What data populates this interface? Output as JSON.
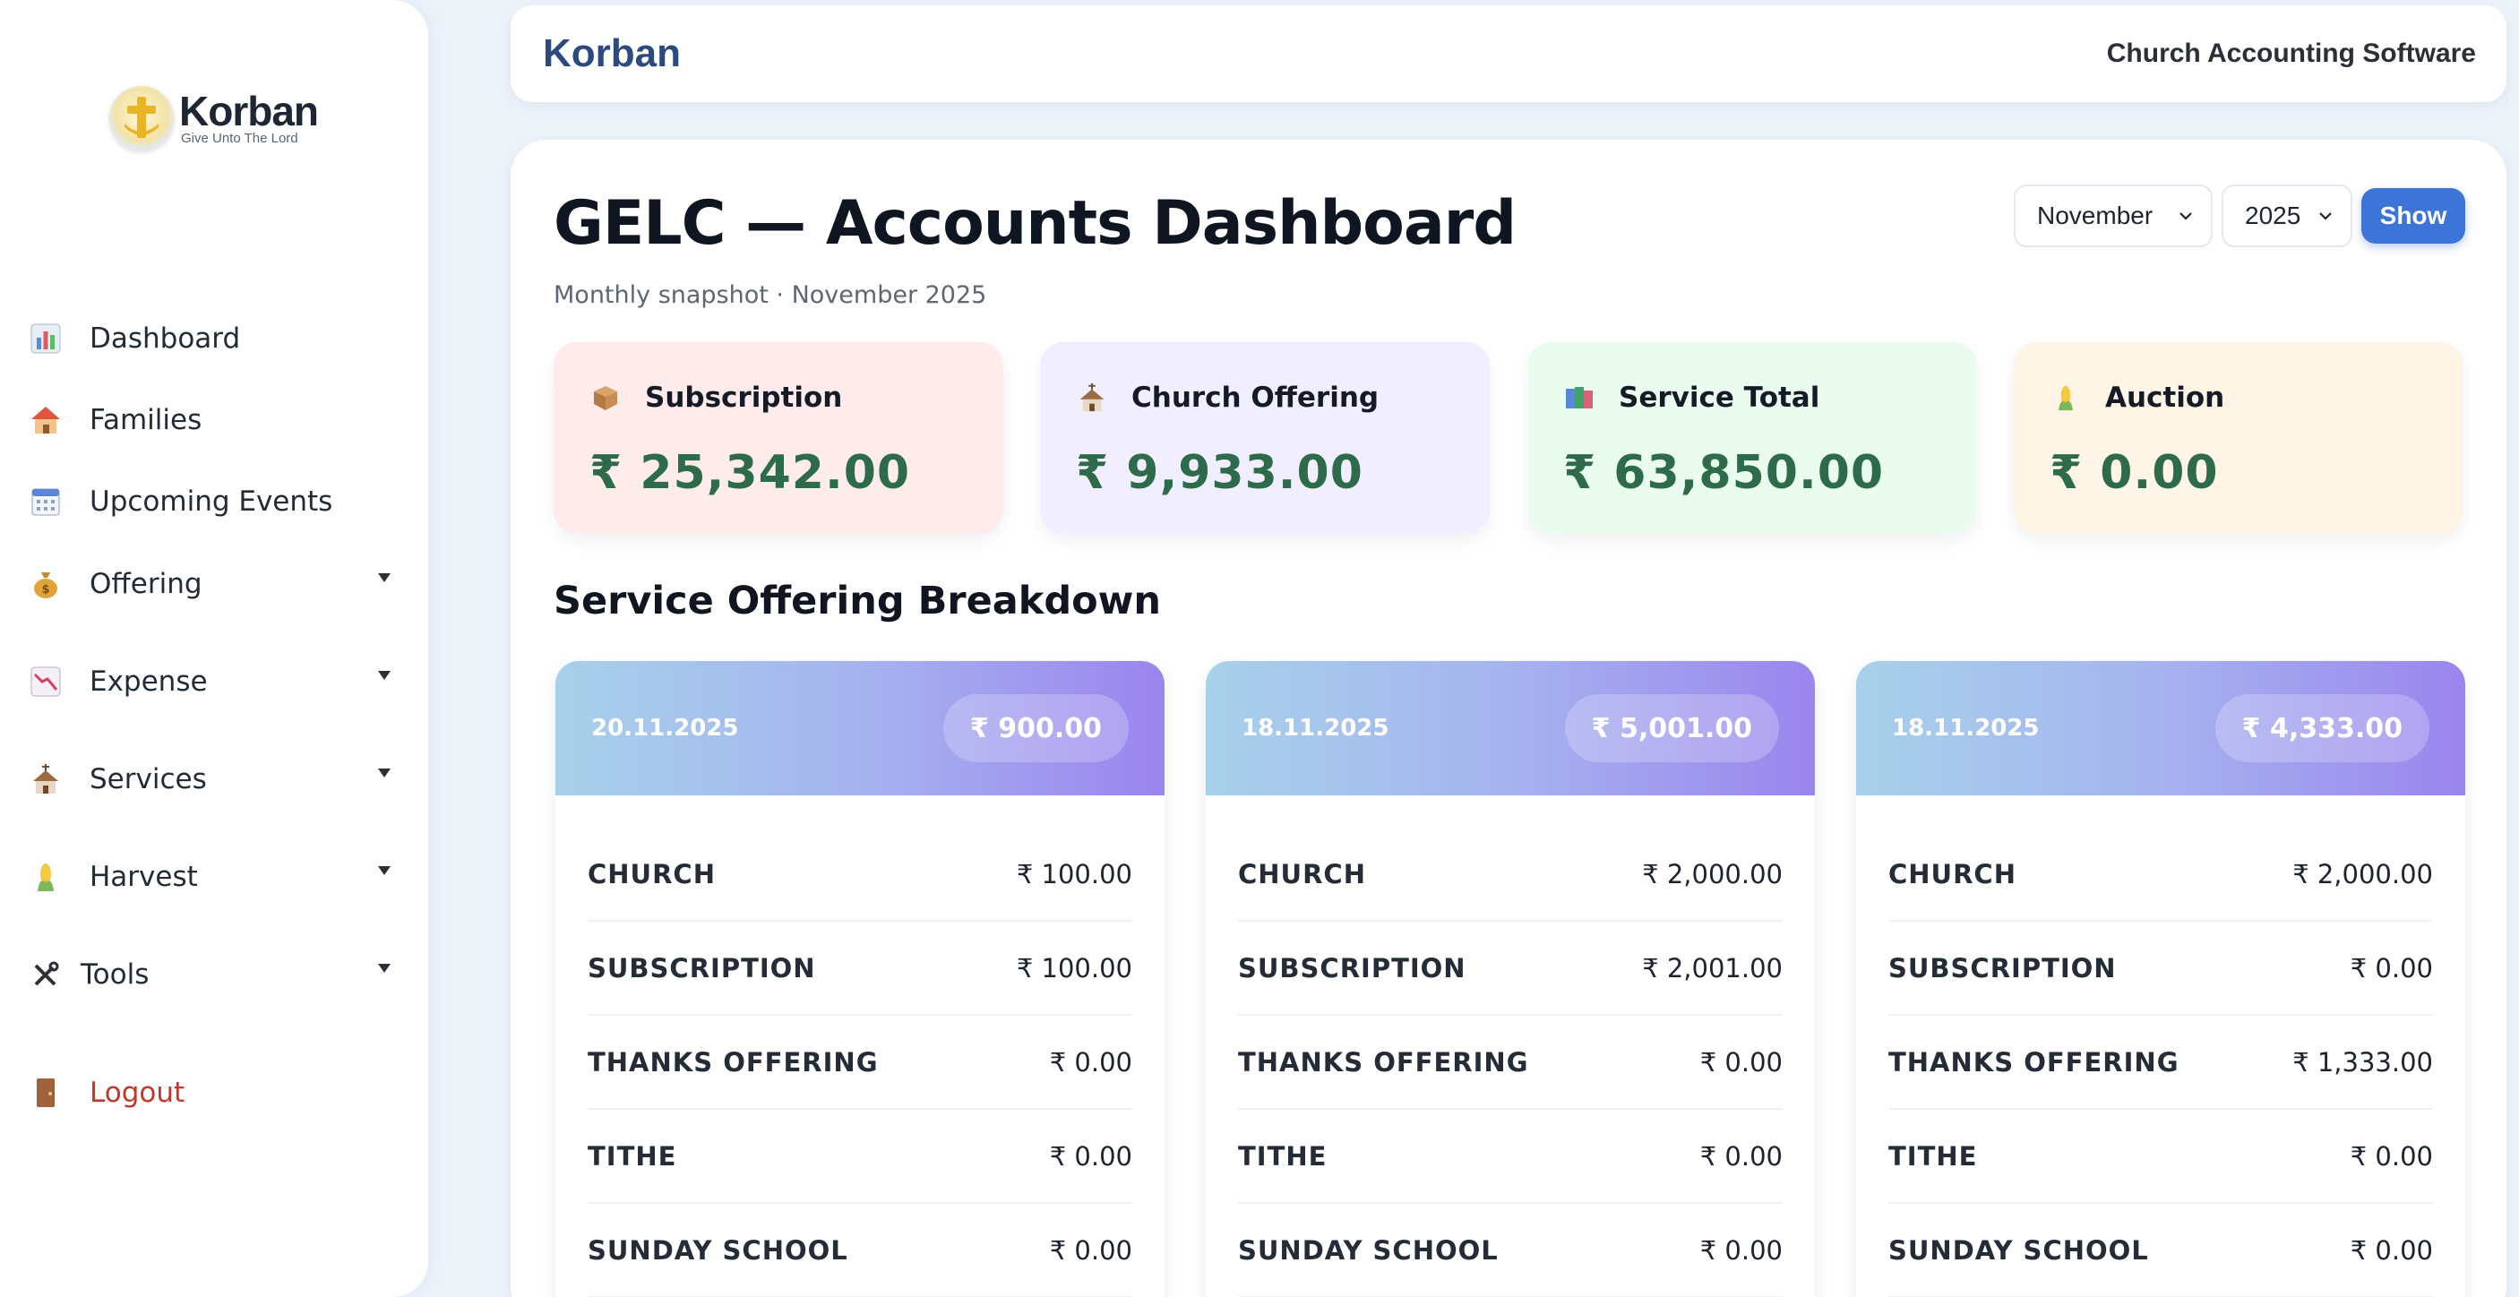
{
  "logo": {
    "name": "Korban",
    "tagline": "Give Unto The Lord"
  },
  "sidebar": {
    "items": [
      {
        "label": "Dashboard",
        "icon": "bar-chart-icon",
        "has_submenu": false
      },
      {
        "label": "Families",
        "icon": "house-icon",
        "has_submenu": false
      },
      {
        "label": "Upcoming Events",
        "icon": "calendar-icon",
        "has_submenu": false
      },
      {
        "label": "Offering",
        "icon": "money-bag-icon",
        "has_submenu": true
      },
      {
        "label": "Expense",
        "icon": "chart-decreasing-icon",
        "has_submenu": true
      },
      {
        "label": "Services",
        "icon": "church-icon",
        "has_submenu": true
      },
      {
        "label": "Harvest",
        "icon": "corn-icon",
        "has_submenu": true
      },
      {
        "label": "Tools",
        "icon": "tools-icon",
        "has_submenu": true
      }
    ],
    "logout": {
      "label": "Logout",
      "icon": "door-icon"
    }
  },
  "topbar": {
    "brand": "Korban",
    "subtitle": "Church Accounting Software"
  },
  "page": {
    "title": "GELC — Accounts Dashboard",
    "subtitle": "Monthly snapshot · November 2025"
  },
  "filters": {
    "month": "November",
    "year": "2025",
    "show_label": "Show"
  },
  "stats": [
    {
      "label": "Subscription",
      "value": "₹ 25,342.00",
      "icon": "package-icon",
      "bg": "#fdeceb"
    },
    {
      "label": "Church Offering",
      "value": "₹ 9,933.00",
      "icon": "church-icon",
      "bg": "#f1efff"
    },
    {
      "label": "Service Total",
      "value": "₹ 63,850.00",
      "icon": "books-icon",
      "bg": "#eafbf0"
    },
    {
      "label": "Auction",
      "value": "₹ 0.00",
      "icon": "corn-icon",
      "bg": "#fff5e6"
    }
  ],
  "breakdown": {
    "title": "Service Offering Breakdown",
    "cards": [
      {
        "date": "20.11.2025",
        "total": "₹ 900.00",
        "rows": [
          {
            "name": "CHURCH",
            "amount": "₹ 100.00"
          },
          {
            "name": "SUBSCRIPTION",
            "amount": "₹ 100.00"
          },
          {
            "name": "THANKS OFFERING",
            "amount": "₹ 0.00"
          },
          {
            "name": "TITHE",
            "amount": "₹ 0.00"
          },
          {
            "name": "SUNDAY SCHOOL",
            "amount": "₹ 0.00"
          }
        ]
      },
      {
        "date": "18.11.2025",
        "total": "₹ 5,001.00",
        "rows": [
          {
            "name": "CHURCH",
            "amount": "₹ 2,000.00"
          },
          {
            "name": "SUBSCRIPTION",
            "amount": "₹ 2,001.00"
          },
          {
            "name": "THANKS OFFERING",
            "amount": "₹ 0.00"
          },
          {
            "name": "TITHE",
            "amount": "₹ 0.00"
          },
          {
            "name": "SUNDAY SCHOOL",
            "amount": "₹ 0.00"
          }
        ]
      },
      {
        "date": "18.11.2025",
        "total": "₹ 4,333.00",
        "rows": [
          {
            "name": "CHURCH",
            "amount": "₹ 2,000.00"
          },
          {
            "name": "SUBSCRIPTION",
            "amount": "₹ 0.00"
          },
          {
            "name": "THANKS OFFERING",
            "amount": "₹ 1,333.00"
          },
          {
            "name": "TITHE",
            "amount": "₹ 0.00"
          },
          {
            "name": "SUNDAY SCHOOL",
            "amount": "₹ 0.00"
          }
        ]
      }
    ]
  },
  "colors": {
    "accent": "#3d74d8",
    "brand": "#2c4a7e",
    "stat_value": "#2e6b4a",
    "logout": "#c0392b"
  }
}
